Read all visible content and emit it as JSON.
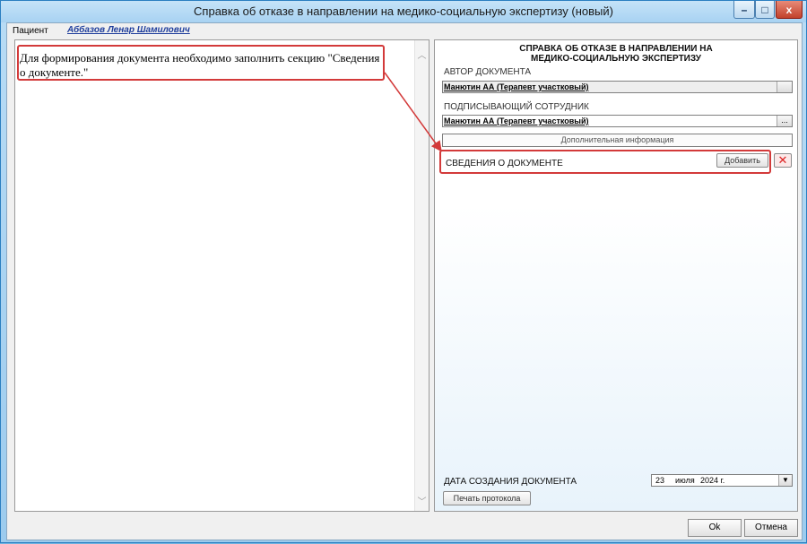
{
  "window": {
    "title": "Справка об отказе в направлении на медико-социальную экспертизу (новый)",
    "controls": {
      "minimize": "–",
      "maximize": "□",
      "close": "x"
    }
  },
  "patient": {
    "label": "Пациент",
    "name": "Аббазов Ленар Шамилович"
  },
  "left_panel": {
    "message": "Для формирования документа необходимо заполнить секцию \"Сведения о документе.\""
  },
  "document": {
    "title": "СПРАВКА ОБ ОТКАЗЕ В НАПРАВЛЕНИИ НА МЕДИКО-СОЦИАЛЬНУЮ ЭКСПЕРТИЗУ",
    "author_label": "АВТОР ДОКУМЕНТА",
    "author_value": "Манютин АА (Терапевт участковый)",
    "signer_label": "ПОДПИСЫВАЮЩИЙ СОТРУДНИК",
    "signer_value": "Манютин АА (Терапевт участковый)",
    "additional_info_label": "Дополнительная информация",
    "section_label": "СВЕДЕНИЯ О ДОКУМЕНТЕ",
    "add_button": "Добавить",
    "ellipsis": "..."
  },
  "date": {
    "label": "ДАТА СОЗДАНИЯ ДОКУМЕНТА",
    "day": "23",
    "month": "июля",
    "year": "2024 г."
  },
  "print_button": "Печать протокола",
  "footer": {
    "ok": "Ok",
    "cancel": "Отмена"
  },
  "colors": {
    "highlight": "#d33a3a",
    "title_bar": "#b9dcf5",
    "link": "#1f3e9c"
  }
}
